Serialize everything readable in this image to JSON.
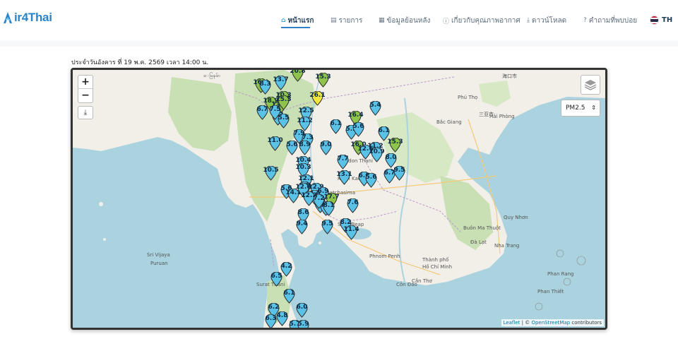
{
  "app": {
    "logo_text": "ir4Thai",
    "brand_color": "#2a84c8"
  },
  "nav": {
    "items": [
      {
        "label": "หน้าแรก",
        "icon": "home-icon",
        "active": true
      },
      {
        "label": "รายการ",
        "icon": "list-icon",
        "active": false
      },
      {
        "label": "ข้อมูลย้อนหลัง",
        "icon": "table-icon",
        "active": false
      },
      {
        "label": "เกี่ยวกับคุณภาพอากาศ",
        "icon": "info-icon",
        "active": false
      },
      {
        "label": "ดาวน์โหลด",
        "icon": "download-icon",
        "active": false
      },
      {
        "label": "คำถามที่พบบ่อย",
        "icon": "question-icon",
        "active": false
      }
    ],
    "language": "TH"
  },
  "report": {
    "date_text": "ประจำวันอังคาร ที่ 19 พ.ค. 2569 เวลา 14:00 น."
  },
  "map": {
    "zoom_in": "+",
    "zoom_out": "−",
    "download_icon": "download-icon",
    "layers_icon": "layers-icon",
    "pollutant_select": "PM2.5",
    "attribution_leaflet": "Leaflet",
    "attribution_sep": " | © ",
    "attribution_osm": "OpenStreetMap",
    "attribution_tail": " contributors",
    "colors": {
      "blue": "#5bc2e7",
      "green": "#8fc44c",
      "yellow": "#f2e53c",
      "sea": "#aad3df",
      "land": "#f2efe9",
      "forest": "#c8e0b4"
    },
    "place_labels": [
      "ေမြနမ်ာ",
      "Hải Phòng",
      "海口市",
      "三亚市",
      "Bắc Giang",
      "Phú Thọ",
      "Sri Vijaya",
      "Puruan",
      "Côn Đảo",
      "Phan Thiết",
      "Phan Rang",
      "Hồ Chí Minh",
      "Thành phố",
      "Cần Thơ",
      "Đà Lạt",
      "Buôn Ma Thuột",
      "Nha Trang",
      "Quy Nhơn",
      "Siem Reap",
      "Phnom Penh",
      "Udon Thani",
      "Khon Kaen",
      "Nakhon Ratchasima",
      "Surat Thani"
    ],
    "stations": [
      {
        "v": "20.8",
        "c": "green"
      },
      {
        "v": "15.3",
        "c": "green"
      },
      {
        "v": "26.1",
        "c": "yellow"
      },
      {
        "v": "16.0",
        "c": "green"
      },
      {
        "v": "13.7",
        "c": "blue"
      },
      {
        "v": "8.3",
        "c": "blue"
      },
      {
        "v": "10.3",
        "c": "green"
      },
      {
        "v": "18.9",
        "c": "green"
      },
      {
        "v": "13.0",
        "c": "green"
      },
      {
        "v": "15.3",
        "c": "green"
      },
      {
        "v": "12.5",
        "c": "blue"
      },
      {
        "v": "5.3",
        "c": "blue"
      },
      {
        "v": "6.7",
        "c": "blue"
      },
      {
        "v": "7.5",
        "c": "blue"
      },
      {
        "v": "5.5",
        "c": "blue"
      },
      {
        "v": "11.2",
        "c": "blue"
      },
      {
        "v": "16.4",
        "c": "green"
      },
      {
        "v": "5.4",
        "c": "blue"
      },
      {
        "v": "6.1",
        "c": "blue"
      },
      {
        "v": "5.2",
        "c": "blue"
      },
      {
        "v": "5.6",
        "c": "blue"
      },
      {
        "v": "6.1",
        "c": "blue"
      },
      {
        "v": "7.9",
        "c": "blue"
      },
      {
        "v": "7.3",
        "c": "blue"
      },
      {
        "v": "11.0",
        "c": "blue"
      },
      {
        "v": "5.6",
        "c": "blue"
      },
      {
        "v": "8.9",
        "c": "blue"
      },
      {
        "v": "9.0",
        "c": "blue"
      },
      {
        "v": "16.0",
        "c": "green"
      },
      {
        "v": "11.2",
        "c": "blue"
      },
      {
        "v": "12.6",
        "c": "blue"
      },
      {
        "v": "10.9",
        "c": "blue"
      },
      {
        "v": "15.3",
        "c": "green"
      },
      {
        "v": "8.0",
        "c": "blue"
      },
      {
        "v": "10.4",
        "c": "blue"
      },
      {
        "v": "7.7",
        "c": "blue"
      },
      {
        "v": "10.5",
        "c": "blue"
      },
      {
        "v": "13.1",
        "c": "blue"
      },
      {
        "v": "6.6",
        "c": "blue"
      },
      {
        "v": "5.6",
        "c": "blue"
      },
      {
        "v": "6.7",
        "c": "blue"
      },
      {
        "v": "9.5",
        "c": "blue"
      },
      {
        "v": "10.3",
        "c": "blue"
      },
      {
        "v": "12.1",
        "c": "blue"
      },
      {
        "v": "9.8",
        "c": "blue"
      },
      {
        "v": "5.6",
        "c": "blue"
      },
      {
        "v": "14.1",
        "c": "blue"
      },
      {
        "v": "12.0",
        "c": "blue"
      },
      {
        "v": "12.9",
        "c": "blue"
      },
      {
        "v": "6.9",
        "c": "blue"
      },
      {
        "v": "7.6",
        "c": "blue"
      },
      {
        "v": "12.2",
        "c": "blue"
      },
      {
        "v": "17.7",
        "c": "green"
      },
      {
        "v": "7.6",
        "c": "blue"
      },
      {
        "v": "7.7",
        "c": "blue"
      },
      {
        "v": "8.6",
        "c": "blue"
      },
      {
        "v": "9.4",
        "c": "blue"
      },
      {
        "v": "9.5",
        "c": "blue"
      },
      {
        "v": "8.2",
        "c": "blue"
      },
      {
        "v": "11.4",
        "c": "blue"
      },
      {
        "v": "7.6",
        "c": "blue"
      },
      {
        "v": "4.2",
        "c": "blue"
      },
      {
        "v": "6.5",
        "c": "blue"
      },
      {
        "v": "6.1",
        "c": "blue"
      },
      {
        "v": "6.2",
        "c": "blue"
      },
      {
        "v": "6.0",
        "c": "blue"
      },
      {
        "v": "4.8",
        "c": "blue"
      },
      {
        "v": "6.3",
        "c": "blue"
      },
      {
        "v": "5.7",
        "c": "blue"
      },
      {
        "v": "5.9",
        "c": "blue"
      },
      {
        "v": "8.1",
        "c": "blue"
      },
      {
        "v": "7.2",
        "c": "blue"
      }
    ]
  }
}
